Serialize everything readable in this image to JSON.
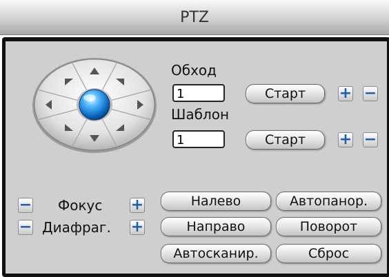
{
  "window": {
    "title": "PTZ"
  },
  "dpad": {
    "directions": [
      "up",
      "up-right",
      "right",
      "down-right",
      "down",
      "down-left",
      "left",
      "up-left"
    ]
  },
  "cruise": {
    "label": "Обход",
    "value": "1",
    "start_label": "Старт",
    "plus": "+",
    "minus": "−"
  },
  "pattern": {
    "label": "Шаблон",
    "value": "1",
    "start_label": "Старт",
    "plus": "+",
    "minus": "−"
  },
  "focus": {
    "label": "Фокус",
    "plus": "+",
    "minus": "−"
  },
  "iris": {
    "label": "Диафраг.",
    "plus": "+",
    "minus": "−"
  },
  "buttons": {
    "left": "Налево",
    "auto_pan": "Автопанор.",
    "right": "Направо",
    "rotate": "Поворот",
    "auto_scan": "Автосканир.",
    "reset": "Сброс"
  },
  "colors": {
    "accent": "#1d5fa8",
    "orb": "#1a8fe0"
  }
}
